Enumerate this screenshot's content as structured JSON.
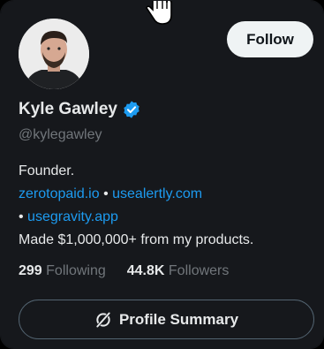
{
  "profile": {
    "display_name": "Kyle Gawley",
    "handle": "@kylegawley",
    "verified_badge": "verified-badge-icon",
    "avatar_alt": "Kyle Gawley avatar"
  },
  "follow_label": "Follow",
  "bio": {
    "line1": "Founder.",
    "link1": "zerotopaid.io",
    "sep1": " • ",
    "link2": "usealertly.com",
    "bullet": "• ",
    "link3": "usegravity.app",
    "line4": "Made $1,000,000+ from my products."
  },
  "stats": {
    "following_count": "299",
    "following_label": "Following",
    "followers_count": "44.8K",
    "followers_label": "Followers"
  },
  "summary_button": {
    "label": "Profile Summary"
  },
  "colors": {
    "background": "#16181c",
    "text_primary": "#e7e9ea",
    "text_secondary": "#71767b",
    "link": "#1d9bf0",
    "verified": "#1d9bf0"
  }
}
